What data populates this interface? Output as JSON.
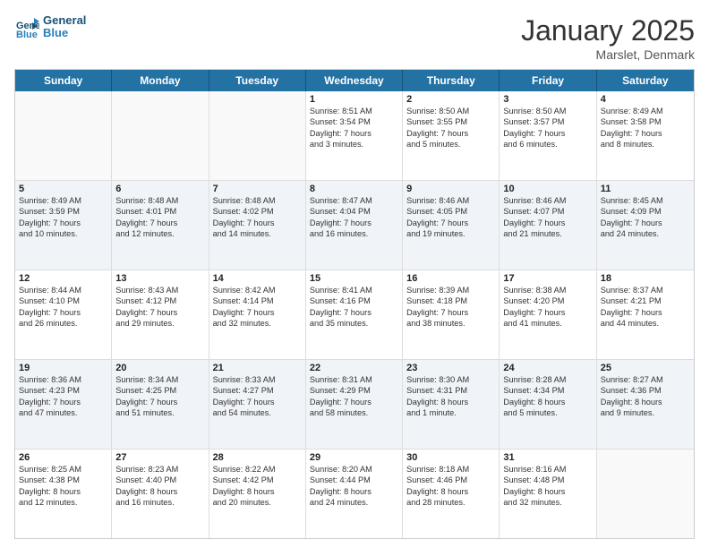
{
  "header": {
    "logo_line1": "General",
    "logo_line2": "Blue",
    "title": "January 2025",
    "subtitle": "Marslet, Denmark"
  },
  "days_of_week": [
    "Sunday",
    "Monday",
    "Tuesday",
    "Wednesday",
    "Thursday",
    "Friday",
    "Saturday"
  ],
  "weeks": [
    [
      {
        "day": "",
        "info": ""
      },
      {
        "day": "",
        "info": ""
      },
      {
        "day": "",
        "info": ""
      },
      {
        "day": "1",
        "info": "Sunrise: 8:51 AM\nSunset: 3:54 PM\nDaylight: 7 hours\nand 3 minutes."
      },
      {
        "day": "2",
        "info": "Sunrise: 8:50 AM\nSunset: 3:55 PM\nDaylight: 7 hours\nand 5 minutes."
      },
      {
        "day": "3",
        "info": "Sunrise: 8:50 AM\nSunset: 3:57 PM\nDaylight: 7 hours\nand 6 minutes."
      },
      {
        "day": "4",
        "info": "Sunrise: 8:49 AM\nSunset: 3:58 PM\nDaylight: 7 hours\nand 8 minutes."
      }
    ],
    [
      {
        "day": "5",
        "info": "Sunrise: 8:49 AM\nSunset: 3:59 PM\nDaylight: 7 hours\nand 10 minutes."
      },
      {
        "day": "6",
        "info": "Sunrise: 8:48 AM\nSunset: 4:01 PM\nDaylight: 7 hours\nand 12 minutes."
      },
      {
        "day": "7",
        "info": "Sunrise: 8:48 AM\nSunset: 4:02 PM\nDaylight: 7 hours\nand 14 minutes."
      },
      {
        "day": "8",
        "info": "Sunrise: 8:47 AM\nSunset: 4:04 PM\nDaylight: 7 hours\nand 16 minutes."
      },
      {
        "day": "9",
        "info": "Sunrise: 8:46 AM\nSunset: 4:05 PM\nDaylight: 7 hours\nand 19 minutes."
      },
      {
        "day": "10",
        "info": "Sunrise: 8:46 AM\nSunset: 4:07 PM\nDaylight: 7 hours\nand 21 minutes."
      },
      {
        "day": "11",
        "info": "Sunrise: 8:45 AM\nSunset: 4:09 PM\nDaylight: 7 hours\nand 24 minutes."
      }
    ],
    [
      {
        "day": "12",
        "info": "Sunrise: 8:44 AM\nSunset: 4:10 PM\nDaylight: 7 hours\nand 26 minutes."
      },
      {
        "day": "13",
        "info": "Sunrise: 8:43 AM\nSunset: 4:12 PM\nDaylight: 7 hours\nand 29 minutes."
      },
      {
        "day": "14",
        "info": "Sunrise: 8:42 AM\nSunset: 4:14 PM\nDaylight: 7 hours\nand 32 minutes."
      },
      {
        "day": "15",
        "info": "Sunrise: 8:41 AM\nSunset: 4:16 PM\nDaylight: 7 hours\nand 35 minutes."
      },
      {
        "day": "16",
        "info": "Sunrise: 8:39 AM\nSunset: 4:18 PM\nDaylight: 7 hours\nand 38 minutes."
      },
      {
        "day": "17",
        "info": "Sunrise: 8:38 AM\nSunset: 4:20 PM\nDaylight: 7 hours\nand 41 minutes."
      },
      {
        "day": "18",
        "info": "Sunrise: 8:37 AM\nSunset: 4:21 PM\nDaylight: 7 hours\nand 44 minutes."
      }
    ],
    [
      {
        "day": "19",
        "info": "Sunrise: 8:36 AM\nSunset: 4:23 PM\nDaylight: 7 hours\nand 47 minutes."
      },
      {
        "day": "20",
        "info": "Sunrise: 8:34 AM\nSunset: 4:25 PM\nDaylight: 7 hours\nand 51 minutes."
      },
      {
        "day": "21",
        "info": "Sunrise: 8:33 AM\nSunset: 4:27 PM\nDaylight: 7 hours\nand 54 minutes."
      },
      {
        "day": "22",
        "info": "Sunrise: 8:31 AM\nSunset: 4:29 PM\nDaylight: 7 hours\nand 58 minutes."
      },
      {
        "day": "23",
        "info": "Sunrise: 8:30 AM\nSunset: 4:31 PM\nDaylight: 8 hours\nand 1 minute."
      },
      {
        "day": "24",
        "info": "Sunrise: 8:28 AM\nSunset: 4:34 PM\nDaylight: 8 hours\nand 5 minutes."
      },
      {
        "day": "25",
        "info": "Sunrise: 8:27 AM\nSunset: 4:36 PM\nDaylight: 8 hours\nand 9 minutes."
      }
    ],
    [
      {
        "day": "26",
        "info": "Sunrise: 8:25 AM\nSunset: 4:38 PM\nDaylight: 8 hours\nand 12 minutes."
      },
      {
        "day": "27",
        "info": "Sunrise: 8:23 AM\nSunset: 4:40 PM\nDaylight: 8 hours\nand 16 minutes."
      },
      {
        "day": "28",
        "info": "Sunrise: 8:22 AM\nSunset: 4:42 PM\nDaylight: 8 hours\nand 20 minutes."
      },
      {
        "day": "29",
        "info": "Sunrise: 8:20 AM\nSunset: 4:44 PM\nDaylight: 8 hours\nand 24 minutes."
      },
      {
        "day": "30",
        "info": "Sunrise: 8:18 AM\nSunset: 4:46 PM\nDaylight: 8 hours\nand 28 minutes."
      },
      {
        "day": "31",
        "info": "Sunrise: 8:16 AM\nSunset: 4:48 PM\nDaylight: 8 hours\nand 32 minutes."
      },
      {
        "day": "",
        "info": ""
      }
    ]
  ]
}
